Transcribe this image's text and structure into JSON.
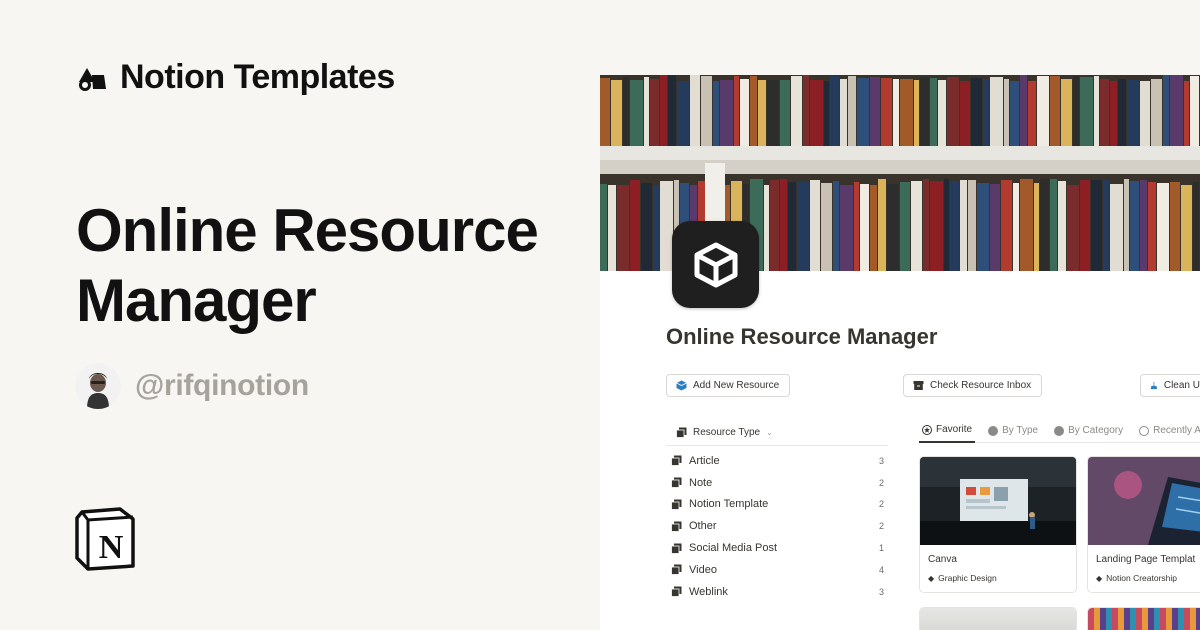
{
  "brand": {
    "name": "Notion Templates"
  },
  "hero": {
    "title": "Online Resource Manager"
  },
  "author": {
    "handle": "@rifqinotion"
  },
  "preview": {
    "page_title": "Online Resource Manager",
    "buttons": {
      "add": "Add New Resource",
      "inbox": "Check Resource Inbox",
      "clean": "Clean U"
    },
    "list": {
      "header": "Resource Type",
      "items": [
        {
          "label": "Article",
          "count": "3"
        },
        {
          "label": "Note",
          "count": "2"
        },
        {
          "label": "Notion Template",
          "count": "2"
        },
        {
          "label": "Other",
          "count": "2"
        },
        {
          "label": "Social Media Post",
          "count": "1"
        },
        {
          "label": "Video",
          "count": "4"
        },
        {
          "label": "Weblink",
          "count": "3"
        }
      ]
    },
    "tabs": [
      {
        "label": "Favorite"
      },
      {
        "label": "By Type"
      },
      {
        "label": "By Category"
      },
      {
        "label": "Recently A"
      }
    ],
    "cards": [
      {
        "title": "Canva",
        "tag": "Graphic Design"
      },
      {
        "title": "Landing Page Templat",
        "tag": "Notion Creatorship"
      }
    ]
  },
  "colors": {
    "background": "#f7f6f3",
    "text_primary": "#111111",
    "text_muted": "#a6a39d",
    "notion_text": "#37352f",
    "icon_dark": "#1f1f1f"
  },
  "icons": {
    "brand": "shapes-logo-icon",
    "page": "cube-icon",
    "notion": "notion-logo-icon",
    "list_item": "document-stack-icon",
    "tab_favorite": "star-icon"
  }
}
